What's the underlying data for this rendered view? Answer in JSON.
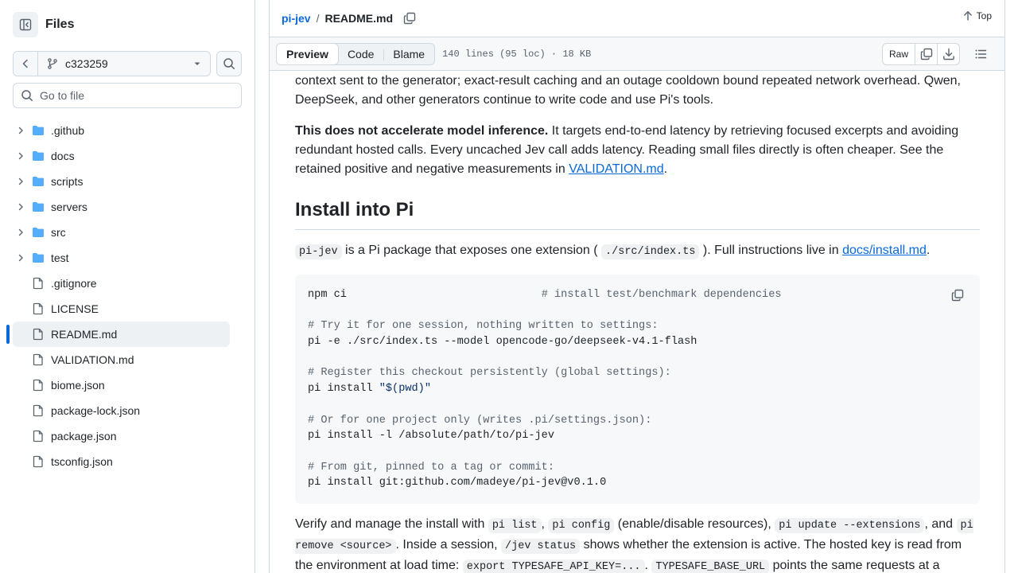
{
  "sidebar": {
    "title": "Files",
    "branch": "c323259",
    "goto_placeholder": "Go to file",
    "items": [
      {
        "label": ".github",
        "type": "dir"
      },
      {
        "label": "docs",
        "type": "dir"
      },
      {
        "label": "scripts",
        "type": "dir"
      },
      {
        "label": "servers",
        "type": "dir"
      },
      {
        "label": "src",
        "type": "dir"
      },
      {
        "label": "test",
        "type": "dir"
      },
      {
        "label": ".gitignore",
        "type": "file"
      },
      {
        "label": "LICENSE",
        "type": "file"
      },
      {
        "label": "README.md",
        "type": "file",
        "active": true
      },
      {
        "label": "VALIDATION.md",
        "type": "file"
      },
      {
        "label": "biome.json",
        "type": "file"
      },
      {
        "label": "package-lock.json",
        "type": "file"
      },
      {
        "label": "package.json",
        "type": "file"
      },
      {
        "label": "tsconfig.json",
        "type": "file"
      }
    ]
  },
  "header": {
    "repo": "pi-jev",
    "sep": "/",
    "file": "README.md",
    "top_label": "Top"
  },
  "toolbar": {
    "tabs": [
      "Preview",
      "Code",
      "Blame"
    ],
    "active_tab": "Preview",
    "meta": "140 lines (95 loc) · 18 KB",
    "raw_label": "Raw"
  },
  "content": {
    "p1": "context sent to the generator; exact-result caching and an outage cooldown bound repeated network overhead. Qwen, DeepSeek, and other generators continue to write code and use Pi's tools.",
    "p2_bold": "This does not accelerate model inference.",
    "p2_text": " It targets end-to-end latency by retrieving focused excerpts and avoiding redundant hosted calls. Every uncached Jev call adds latency. Reading small files directly is often cheaper. See the retained positive and negative measurements in ",
    "p2_link": "VALIDATION.md",
    "p2_end": ".",
    "h2": "Install into Pi",
    "p3_code1": "pi-jev",
    "p3_text1": " is a Pi package that exposes one extension ( ",
    "p3_code2": "./src/index.ts",
    "p3_text2": " ). Full instructions live in ",
    "p3_link": "docs/install.md",
    "p3_end": ".",
    "code_lines": [
      {
        "code": "npm ci                              ",
        "comment": "# install test/benchmark dependencies"
      },
      {
        "code": "",
        "comment": ""
      },
      {
        "code": "",
        "comment": "# Try it for one session, nothing written to settings:"
      },
      {
        "code": "pi -e ./src/index.ts --model opencode-go/deepseek-v4.1-flash",
        "comment": ""
      },
      {
        "code": "",
        "comment": ""
      },
      {
        "code": "",
        "comment": "# Register this checkout persistently (global settings):"
      },
      {
        "code": "pi install ",
        "string": "\"$(pwd)\"",
        "comment": ""
      },
      {
        "code": "",
        "comment": ""
      },
      {
        "code": "",
        "comment": "# Or for one project only (writes .pi/settings.json):"
      },
      {
        "code": "pi install -l /absolute/path/to/pi-jev",
        "comment": ""
      },
      {
        "code": "",
        "comment": ""
      },
      {
        "code": "",
        "comment": "# From git, pinned to a tag or commit:"
      },
      {
        "code": "pi install git:github.com/madeye/pi-jev@v0.1.0",
        "comment": ""
      }
    ],
    "p4_t1": "Verify and manage the install with ",
    "p4_c1": "pi list",
    "p4_t2": ", ",
    "p4_c2": "pi config",
    "p4_t3": " (enable/disable resources), ",
    "p4_c3": "pi update --extensions",
    "p4_t4": ", and ",
    "p4_c4": "pi remove <source>",
    "p4_t5": ". Inside a session, ",
    "p4_c5": "/jev status",
    "p4_t6": " shows whether the extension is active. The hosted key is read from the environment at load time: ",
    "p4_c6": "export TYPESAFE_API_KEY=...",
    "p4_t7": ". ",
    "p4_c7": "TYPESAFE_BASE_URL",
    "p4_t8": " points the same requests at a"
  },
  "colors": {
    "link": "#0969da",
    "folder": "#54aeff",
    "active_marker": "#0969da",
    "border": "#d1d9e0"
  }
}
